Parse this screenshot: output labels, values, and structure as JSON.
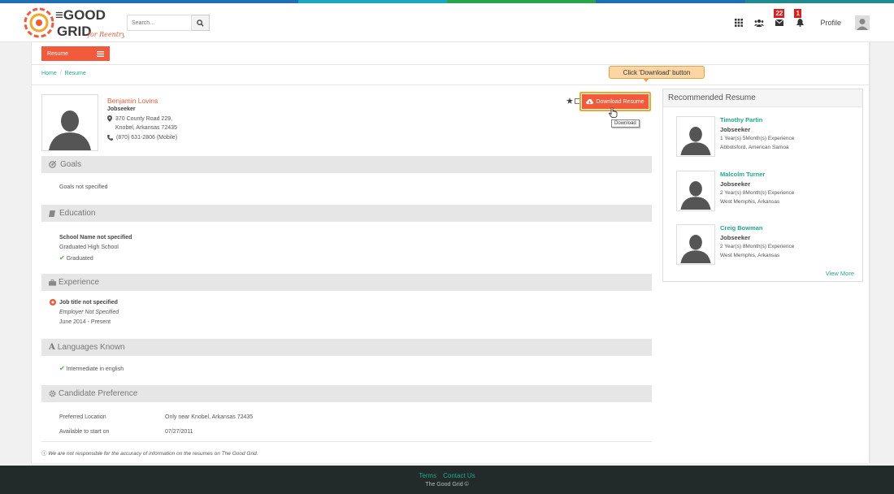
{
  "colors": {
    "accent": "#f15a3a",
    "link": "#1fa98b",
    "strip": [
      "#1f6fb5",
      "#1f6fb5",
      "#1aa7c4",
      "#2aa34a",
      "#1f6fb5",
      "#1f8b8f"
    ]
  },
  "header": {
    "logo_text_line1": "THE GOOD",
    "logo_text_line2": "GRID",
    "logo_tagline": "for Reentry",
    "search_placeholder": "Search...",
    "messages_count": "22",
    "notifications_count": "1",
    "profile_label": "Profile"
  },
  "subnav": {
    "resume_tab": "Resume"
  },
  "breadcrumb": {
    "home": "Home",
    "current": "Resume"
  },
  "candidate": {
    "name": "Benjamin Lovins",
    "role": "Jobseeker",
    "address_line1": "370 County Road 229,",
    "address_line2": "Knobel, Arkansas  72435",
    "phone": "(870) 631-2806 (Mobile)"
  },
  "actions": {
    "download_label": "Download Resume",
    "callout": "Click 'Download' button",
    "tooltip": "Download"
  },
  "sections": {
    "goals": {
      "title": "Goals",
      "text": "Goals not specified"
    },
    "education": {
      "title": "Education",
      "school": "School Name not specified",
      "degree": "Graduated High School",
      "status": "Graduated"
    },
    "experience": {
      "title": "Experience",
      "job_title": "Job title not specified",
      "employer": "Employer Not Specified",
      "dates": "June 2014 - Present"
    },
    "languages": {
      "title": "Languages Known",
      "item": "Intermediate in english"
    },
    "preference": {
      "title": "Candidate Preference",
      "loc_label": "Preferred Location",
      "loc_value": "Only near Knobel, Arkansas 72435",
      "start_label": "Available to start on",
      "start_value": "07/27/2011"
    }
  },
  "disclaimer": "We are not responsible for the accuracy of information on the resumes on The Good Grid.",
  "recommended": {
    "title": "Recommended Resume",
    "items": [
      {
        "name": "Timothy Partin",
        "role": "Jobseeker",
        "experience": "1 Year(s) 5Month(s) Experience",
        "location": "Abbotsford, American Samoa"
      },
      {
        "name": "Malcolm Turner",
        "role": "Jobseeker",
        "experience": "2 Year(s) 8Month(s) Experience",
        "location": "West Memphis, Arkansas"
      },
      {
        "name": "Creig Bowman",
        "role": "Jobseeker",
        "experience": "2 Year(s) 8Month(s) Experience",
        "location": "West Memphis, Arkansas"
      }
    ],
    "view_more": "View More"
  },
  "footer": {
    "terms": "Terms",
    "contact": "Contact Us",
    "copyright": "The Good Grid ©"
  }
}
